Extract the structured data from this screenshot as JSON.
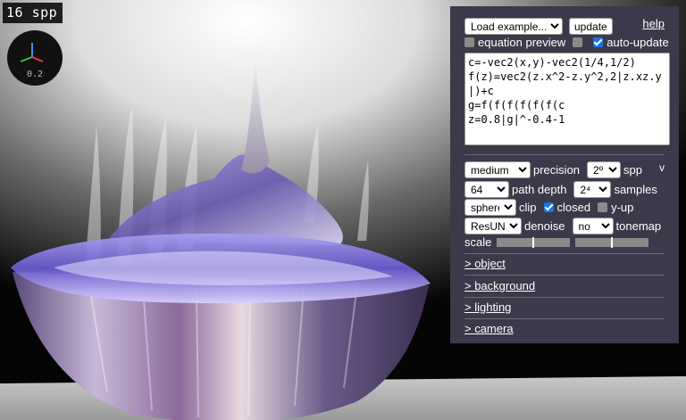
{
  "viewport": {
    "spp_text": "16 spp",
    "axis_scale": "0.2"
  },
  "panel": {
    "load_example_label": "Load example...",
    "update_label": "update",
    "help_label": "help",
    "equation_preview_label": "equation preview",
    "equation_preview_checked": false,
    "unnamed_checkbox_checked": false,
    "auto_update_label": "auto-update",
    "auto_update_checked": true,
    "equation": "c=-vec2(x,y)-vec2(1/4,1/2)\nf(z)=vec2(z.x^2-z.y^2,2|z.xz.y|)+c\ng=f(f(f(f(f(f(c\nz=0.8|g|^-0.4-1",
    "precision_value": "medium",
    "precision_label": "precision",
    "spp_value": "2º",
    "spp_label": "spp",
    "collapse_label": "v",
    "path_depth_value": "64",
    "path_depth_label": "path depth",
    "samples_value": "2⁴",
    "samples_label": "samples",
    "clip_value": "sphere",
    "clip_label": "clip",
    "closed_label": "closed",
    "closed_checked": true,
    "y_up_label": "y-up",
    "y_up_checked": false,
    "denoise_value": "ResUNet",
    "denoise_label": "denoise",
    "tonemap_value": "no",
    "tonemap_label": "tonemap",
    "scale_label": "scale",
    "scale_slider_1": 0.5,
    "scale_slider_2": 0.5,
    "sections": [
      "> object",
      "> background",
      "> lighting",
      "> camera"
    ]
  },
  "colors": {
    "panel_bg": "#3a3a4a",
    "accent": "#1a73e8",
    "object_purple": "#8c7ae6"
  }
}
